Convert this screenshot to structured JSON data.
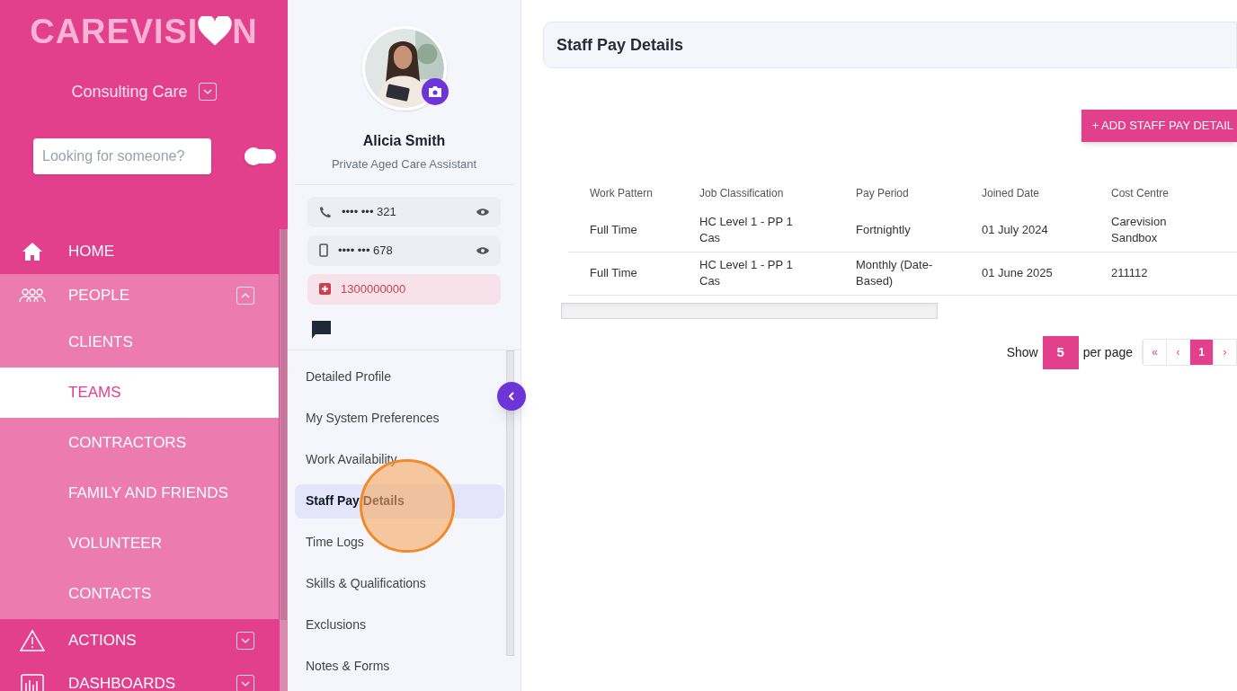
{
  "logo": {
    "before": "CAREVISI",
    "after": "N"
  },
  "organisation": {
    "label": "Consulting Care",
    "expanded": false
  },
  "search": {
    "placeholder": "Looking for someone?"
  },
  "toggle": {
    "on": false
  },
  "nav": [
    {
      "label": "HOME",
      "kind": "top",
      "selected": false
    },
    {
      "label": "PEOPLE",
      "kind": "section",
      "expanded": true,
      "selected": false,
      "children": [
        {
          "label": "CLIENTS",
          "selected": false
        },
        {
          "label": "TEAMS",
          "selected": true
        },
        {
          "label": "CONTRACTORS",
          "selected": false
        },
        {
          "label": "FAMILY AND FRIENDS",
          "selected": false
        },
        {
          "label": "VOLUNTEER",
          "selected": false
        },
        {
          "label": "CONTACTS",
          "selected": false
        }
      ]
    },
    {
      "label": "ACTIONS",
      "kind": "section",
      "expanded": false,
      "selected": false
    },
    {
      "label": "DASHBOARDS",
      "kind": "section",
      "expanded": false,
      "selected": false
    }
  ],
  "profile": {
    "name": "Alicia Smith",
    "role": "Private Aged Care Assistant",
    "contacts": [
      {
        "kind": "phone",
        "value": "•••• ••• 321"
      },
      {
        "kind": "mobile",
        "value": "•••• ••• 678"
      },
      {
        "kind": "emergency",
        "value": "1300000000"
      }
    ],
    "menu": [
      {
        "label": "Detailed Profile",
        "selected": false
      },
      {
        "label": "My System Preferences",
        "selected": false
      },
      {
        "label": "Work Availability",
        "selected": false
      },
      {
        "label": "Staff Pay Details",
        "selected": true
      },
      {
        "label": "Time Logs",
        "selected": false
      },
      {
        "label": "Skills & Qualifications",
        "selected": false
      },
      {
        "label": "Exclusions",
        "selected": false
      },
      {
        "label": "Notes & Forms",
        "selected": false
      }
    ]
  },
  "page": {
    "title": "Staff Pay Details",
    "add_button": "+ ADD STAFF PAY DETAIL"
  },
  "table": {
    "columns": [
      "Work Pattern",
      "Job Classification",
      "Pay Period",
      "Joined Date",
      "Cost Centre"
    ],
    "rows": [
      [
        "Full Time",
        "HC Level 1 - PP 1 Cas",
        "Fortnightly",
        "01 July 2024",
        "Carevision Sandbox"
      ],
      [
        "Full Time",
        "HC Level 1 - PP 1 Cas",
        "Monthly (Date-Based)",
        "01 June 2025",
        "211112"
      ]
    ]
  },
  "pagination": {
    "show_label": "Show",
    "page_size": "5",
    "per_page_label": "per page",
    "buttons": [
      {
        "label": "«",
        "selected": false
      },
      {
        "label": "‹",
        "selected": false
      },
      {
        "label": "1",
        "selected": true
      },
      {
        "label": "›",
        "selected": false
      }
    ]
  }
}
